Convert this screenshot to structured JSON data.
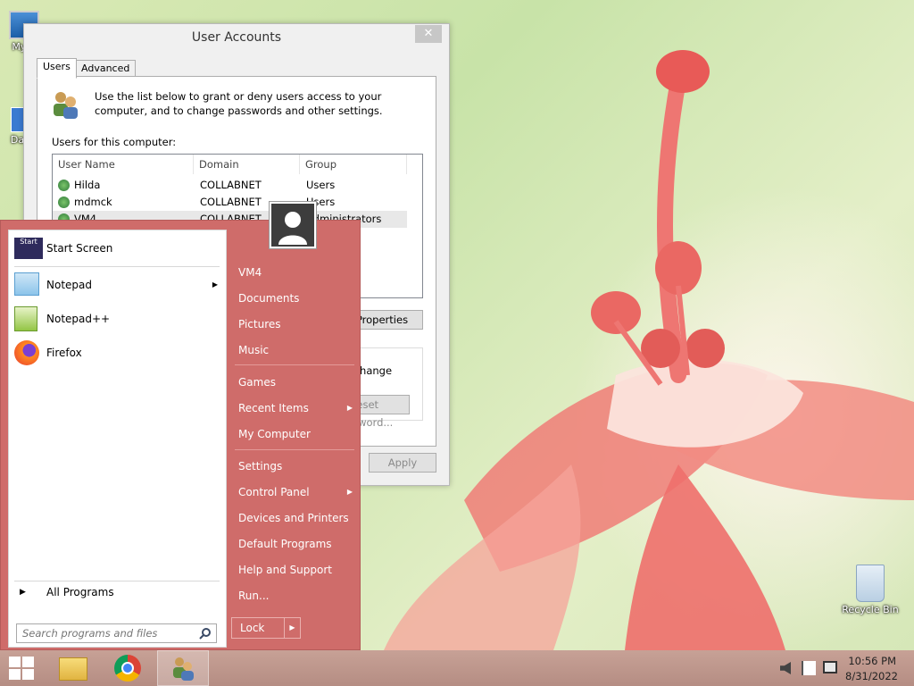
{
  "desktop": {
    "icons": [
      {
        "label": "My C"
      },
      {
        "label": "Data"
      },
      {
        "label": "Recycle Bin"
      }
    ]
  },
  "ua_window": {
    "title": "User Accounts",
    "close_glyph": "✕",
    "tabs": [
      {
        "label": "Users"
      },
      {
        "label": "Advanced"
      }
    ],
    "description": "Use the list below to grant or deny users access to your computer, and to change passwords and other settings.",
    "users_label": "Users for this computer:",
    "columns": [
      "User Name",
      "Domain",
      "Group"
    ],
    "rows": [
      {
        "name": "Hilda",
        "domain": "COLLABNET",
        "group": "Users"
      },
      {
        "name": "mdmck",
        "domain": "COLLABNET",
        "group": "Users"
      },
      {
        "name": "VM4",
        "domain": "COLLABNET",
        "group": "Administrators"
      }
    ],
    "properties_button": "Properties",
    "password_text": "Change",
    "reset_password_button": "Reset Password...",
    "apply_button": "Apply"
  },
  "start_menu": {
    "pinned": [
      {
        "label": "Start Screen",
        "icon": "start-screen-icon"
      },
      {
        "label": "Notepad",
        "icon": "notepad-icon",
        "has_submenu": true
      },
      {
        "label": "Notepad++",
        "icon": "notepad-plus-plus-icon"
      },
      {
        "label": "Firefox",
        "icon": "firefox-icon"
      }
    ],
    "all_programs": "All Programs",
    "search_placeholder": "Search programs and files",
    "right_items": [
      {
        "label": "VM4"
      },
      {
        "label": "Documents"
      },
      {
        "label": "Pictures"
      },
      {
        "label": "Music"
      },
      {
        "label": "Games"
      },
      {
        "label": "Recent Items",
        "has_submenu": true
      },
      {
        "label": "My Computer"
      },
      {
        "label": "Settings"
      },
      {
        "label": "Control Panel",
        "has_submenu": true
      },
      {
        "label": "Devices and Printers"
      },
      {
        "label": "Default Programs"
      },
      {
        "label": "Help and Support"
      },
      {
        "label": "Run..."
      }
    ],
    "lock_label": "Lock",
    "arrow_glyph": "▶"
  },
  "taskbar": {
    "time": "10:56 PM",
    "date": "8/31/2022"
  },
  "colors": {
    "start_menu_bg": "#cf6c6a",
    "taskbar_bg": "#b58d83"
  }
}
